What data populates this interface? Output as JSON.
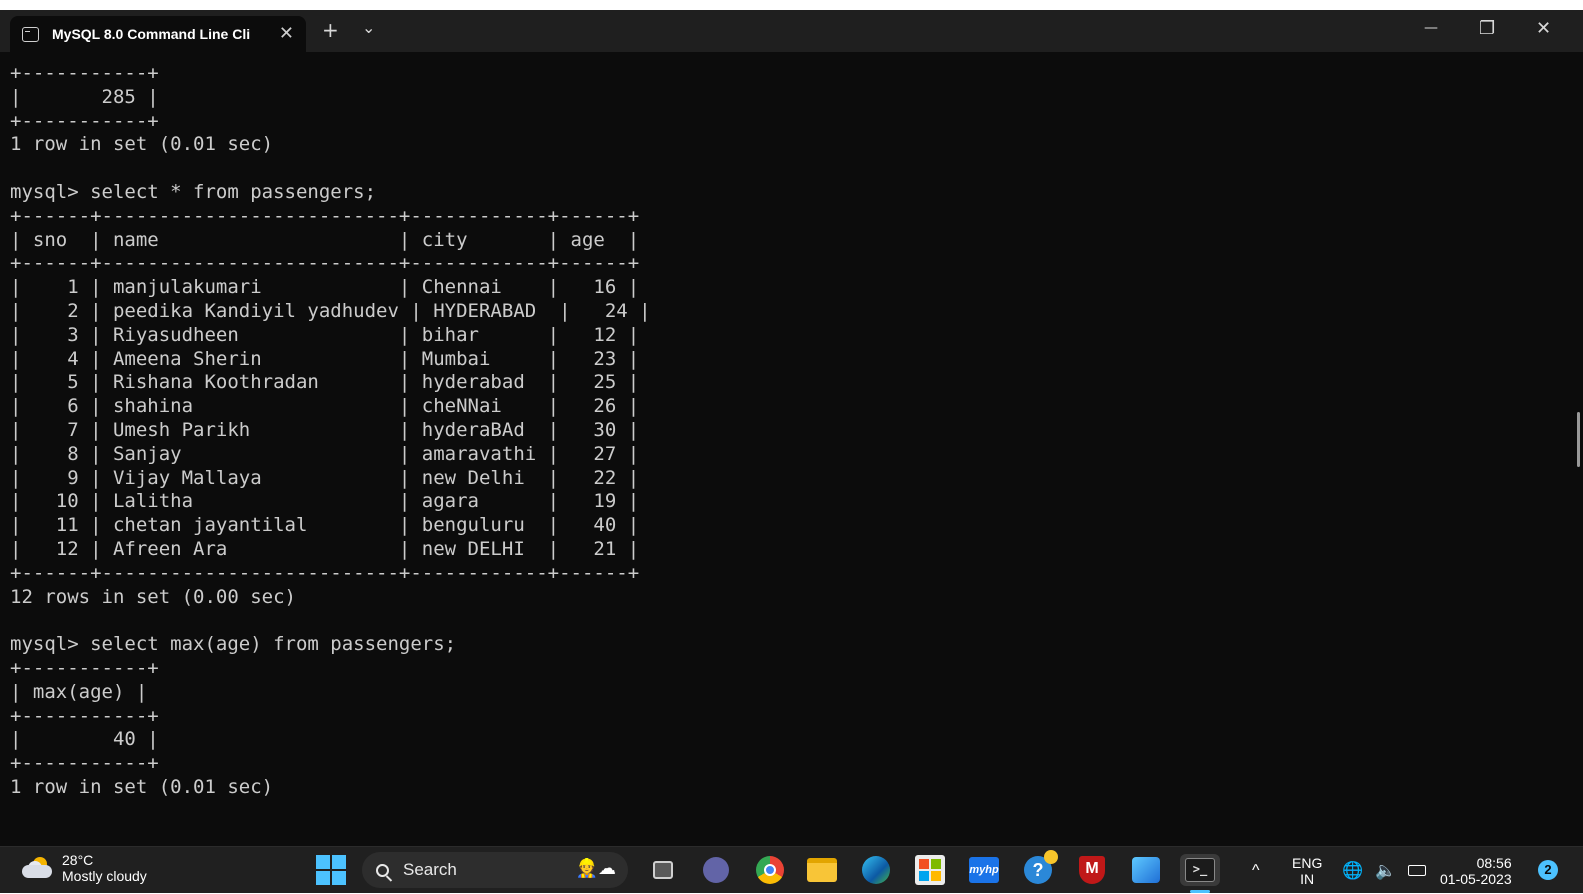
{
  "window": {
    "tab_title": "MySQL 8.0 Command Line Cli",
    "tab_close": "✕",
    "new_tab": "+",
    "dropdown": "⌄",
    "minimize": "—",
    "restore": "❐",
    "close": "✕"
  },
  "terminal": {
    "lines": [
      "+-----------+",
      "|       285 |",
      "+-----------+",
      "1 row in set (0.01 sec)",
      "",
      "mysql> select * from passengers;",
      "+------+--------------------------+------------+------+",
      "| sno  | name                     | city       | age  |",
      "+------+--------------------------+------------+------+",
      "|    1 | manjulakumari            | Chennai    |   16 |",
      "|    2 | peedika Kandiyil yadhudev | HYDERABAD  |   24 |",
      "|    3 | Riyasudheen              | bihar      |   12 |",
      "|    4 | Ameena Sherin            | Mumbai     |   23 |",
      "|    5 | Rishana Koothradan       | hyderabad  |   25 |",
      "|    6 | shahina                  | cheNNai    |   26 |",
      "|    7 | Umesh Parikh             | hyderaBAd  |   30 |",
      "|    8 | Sanjay                   | amaravathi |   27 |",
      "|    9 | Vijay Mallaya            | new Delhi  |   22 |",
      "|   10 | Lalitha                  | agara      |   19 |",
      "|   11 | chetan jayantilal        | benguluru  |   40 |",
      "|   12 | Afreen Ara               | new DELHI  |   21 |",
      "+------+--------------------------+------------+------+",
      "12 rows in set (0.00 sec)",
      "",
      "mysql> select max(age) from passengers;",
      "+-----------+",
      "| max(age) |",
      "+-----------+",
      "|        40 |",
      "+-----------+",
      "1 row in set (0.01 sec)"
    ]
  },
  "taskbar": {
    "temperature": "28°C",
    "weather": "Mostly cloudy",
    "search_label": "Search",
    "lang_top": "ENG",
    "lang_bottom": "IN",
    "time": "08:56",
    "date": "01-05-2023",
    "notifications": "2",
    "hidden_icons": "^"
  },
  "colors": {
    "terminal_bg": "#0c0c0c",
    "terminal_text": "#cccccc",
    "titlebar_bg": "#1f1f1f",
    "taskbar_bg": "#202020",
    "accent": "#4cc2ff"
  }
}
